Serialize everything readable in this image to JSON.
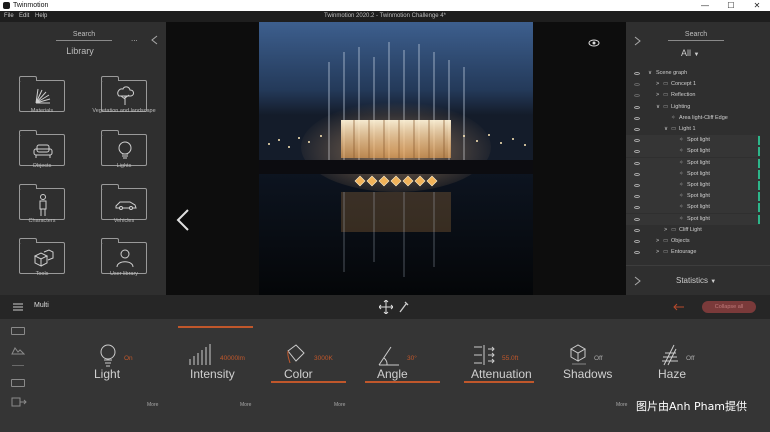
{
  "window": {
    "app_title": "Twinmotion",
    "document_title": "Twinmotion 2020.2 - Twinmotion Challenge 4*",
    "controls": {
      "minimize": "—",
      "maximize": "☐",
      "close": "✕"
    }
  },
  "menu": {
    "items": [
      "File",
      "Edit",
      "Help"
    ]
  },
  "library": {
    "search_label": "Search",
    "title": "Library",
    "more": "...",
    "categories": [
      {
        "label": "Materials",
        "icon": "materials-icon"
      },
      {
        "label": "Vegetation and landscape",
        "icon": "tree-icon"
      },
      {
        "label": "Objects",
        "icon": "sofa-icon"
      },
      {
        "label": "Lights",
        "icon": "bulb-icon"
      },
      {
        "label": "Characters",
        "icon": "person-icon"
      },
      {
        "label": "Vehicles",
        "icon": "car-icon"
      },
      {
        "label": "Tools",
        "icon": "cubes-icon"
      },
      {
        "label": "User library",
        "icon": "user-icon"
      }
    ]
  },
  "scene": {
    "search_label": "Search",
    "filter": "All",
    "tree": [
      {
        "label": "Scene graph",
        "indent": 0,
        "expander": "∨",
        "type": "root"
      },
      {
        "label": "Concept 1",
        "indent": 1,
        "expander": ">",
        "type": "folder"
      },
      {
        "label": "Reflection",
        "indent": 1,
        "expander": ">",
        "type": "folder"
      },
      {
        "label": "Lighting",
        "indent": 1,
        "expander": "∨",
        "type": "folder"
      },
      {
        "label": "Area light-Cliff Edge",
        "indent": 2,
        "expander": "",
        "type": "light"
      },
      {
        "label": "Light 1",
        "indent": 2,
        "expander": "∨",
        "type": "folder"
      },
      {
        "label": "Spot light",
        "indent": 3,
        "expander": "",
        "type": "spot",
        "selected": true
      },
      {
        "label": "Spot light",
        "indent": 3,
        "expander": "",
        "type": "spot",
        "selected": true
      },
      {
        "label": "Spot light",
        "indent": 3,
        "expander": "",
        "type": "spot",
        "selected": true
      },
      {
        "label": "Spot light",
        "indent": 3,
        "expander": "",
        "type": "spot",
        "selected": true
      },
      {
        "label": "Spot light",
        "indent": 3,
        "expander": "",
        "type": "spot",
        "selected": true
      },
      {
        "label": "Spot light",
        "indent": 3,
        "expander": "",
        "type": "spot",
        "selected": true
      },
      {
        "label": "Spot light",
        "indent": 3,
        "expander": "",
        "type": "spot",
        "selected": true
      },
      {
        "label": "Spot light",
        "indent": 3,
        "expander": "",
        "type": "spot",
        "selected": true
      },
      {
        "label": "Cliff Light",
        "indent": 2,
        "expander": ">",
        "type": "folder"
      },
      {
        "label": "Objects",
        "indent": 1,
        "expander": ">",
        "type": "folder"
      },
      {
        "label": "Entourage",
        "indent": 1,
        "expander": ">",
        "type": "folder"
      }
    ],
    "statistics_label": "Statistics"
  },
  "toolbar": {
    "mode": "Multi",
    "collapse_label": "Collapse all"
  },
  "properties": [
    {
      "name": "Light",
      "value": "On",
      "state": "on",
      "icon": "bulb-outline-icon"
    },
    {
      "name": "Intensity",
      "value": "40000lm",
      "state": "on",
      "icon": "bars-icon"
    },
    {
      "name": "Color",
      "value": "3000K",
      "state": "on",
      "icon": "paint-bucket-icon"
    },
    {
      "name": "Angle",
      "value": "30°",
      "state": "on",
      "icon": "angle-icon"
    },
    {
      "name": "Attenuation",
      "value": "55.0ft",
      "state": "on",
      "icon": "attenuation-icon"
    },
    {
      "name": "Shadows",
      "value": "Off",
      "state": "off",
      "icon": "cube-shadow-icon"
    },
    {
      "name": "Haze",
      "value": "Off",
      "state": "off",
      "icon": "haze-icon"
    }
  ],
  "more_label": "More",
  "watermark": "图片由Anh Pham提供",
  "colors": {
    "accent": "#c0572b",
    "selected_bar": "#2db68a",
    "panel": "#2f2f2f",
    "bottom": "#353535"
  }
}
